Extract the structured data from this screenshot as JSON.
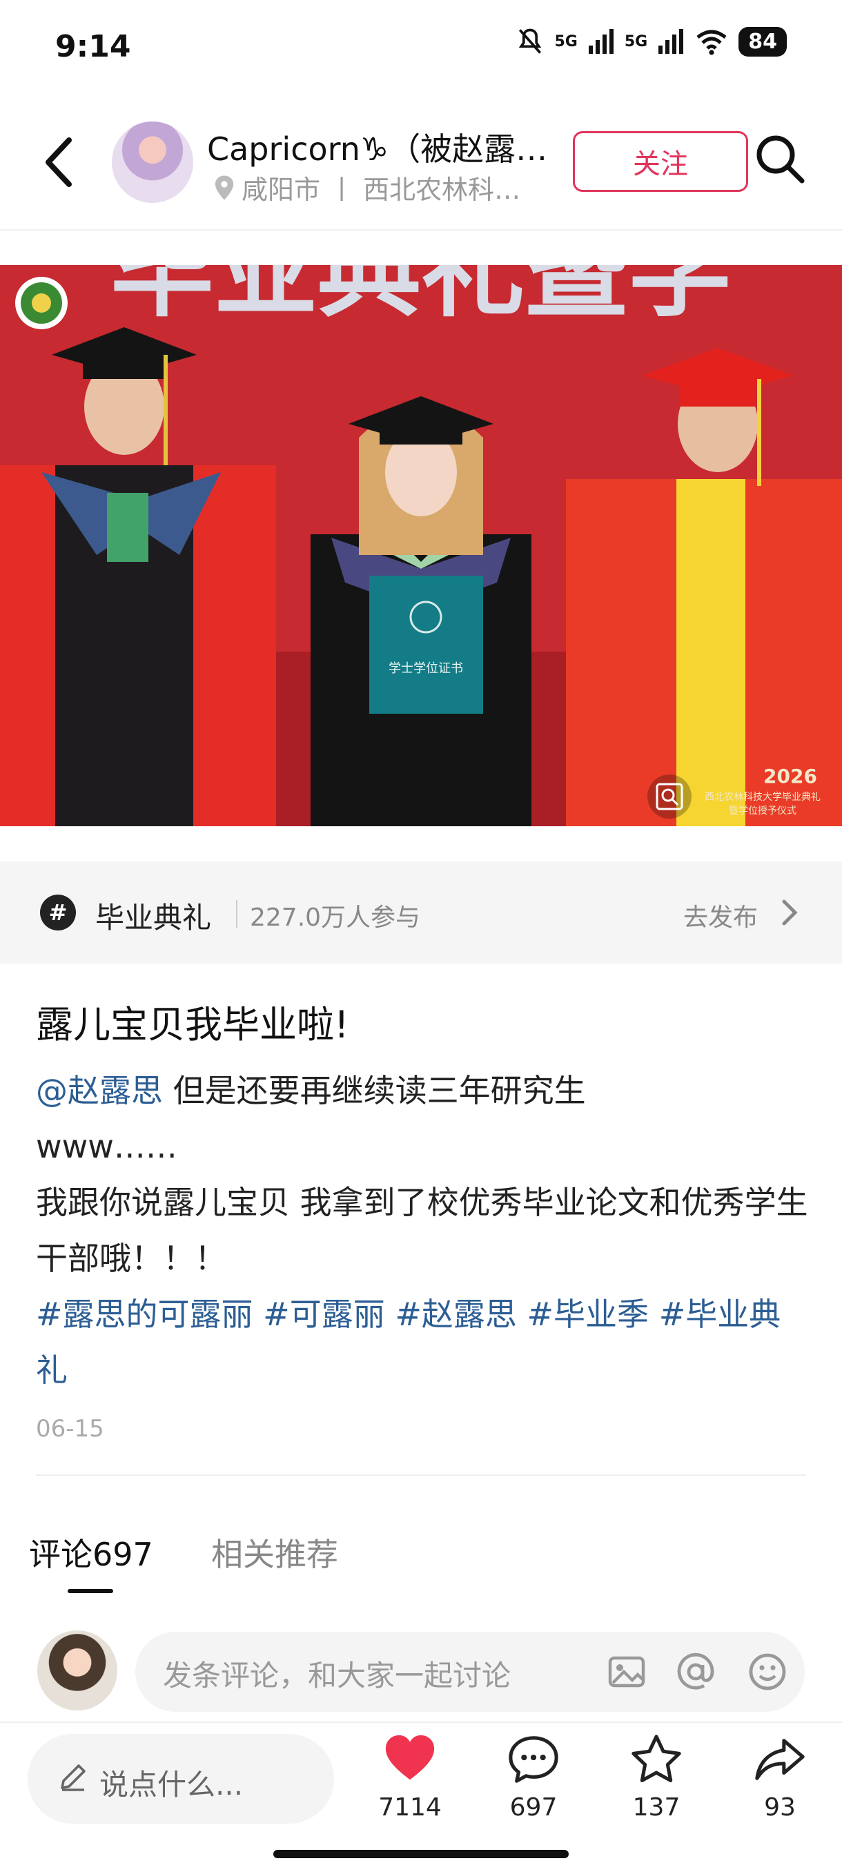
{
  "status_bar": {
    "time": "9:14",
    "signal_1": "5G",
    "signal_2": "5G",
    "battery": "84"
  },
  "header": {
    "author_name": "Capricorn♑（被赵露…",
    "location": "咸阳市 丨 西北农林科…",
    "follow_label": "关注"
  },
  "photo": {
    "banner_text": "毕业典礼暨学",
    "diploma_text": "学士学位证书",
    "corner_year": "2026",
    "corner_line1": "西北农林科技大学毕业典礼",
    "corner_line2": "暨学位授予仪式"
  },
  "topic": {
    "icon": "#",
    "name": "毕业典礼",
    "count": "227.0万人参与",
    "publish": "去发布"
  },
  "note": {
    "title": "露儿宝贝我毕业啦!",
    "mention": "@赵露思",
    "line1_rest": " 但是还要再继续读三年研究生",
    "line2": "www……",
    "line3": "我跟你说露儿宝贝 我拿到了校优秀毕业论文和优秀学生干部哦！！！",
    "tags": [
      "#露思的可露丽",
      "#可露丽",
      "#赵露思",
      "#毕业季",
      "#毕业典礼"
    ],
    "date": "06-15"
  },
  "tabs": {
    "comments_label": "评论",
    "comments_count": "697",
    "related_label": "相关推荐"
  },
  "comment_input": {
    "placeholder": "发条评论，和大家一起讨论"
  },
  "bottom_bar": {
    "say_placeholder": "说点什么...",
    "likes": "7114",
    "comments": "697",
    "favorites": "137",
    "shares": "93",
    "like_color": "#f0334f"
  }
}
